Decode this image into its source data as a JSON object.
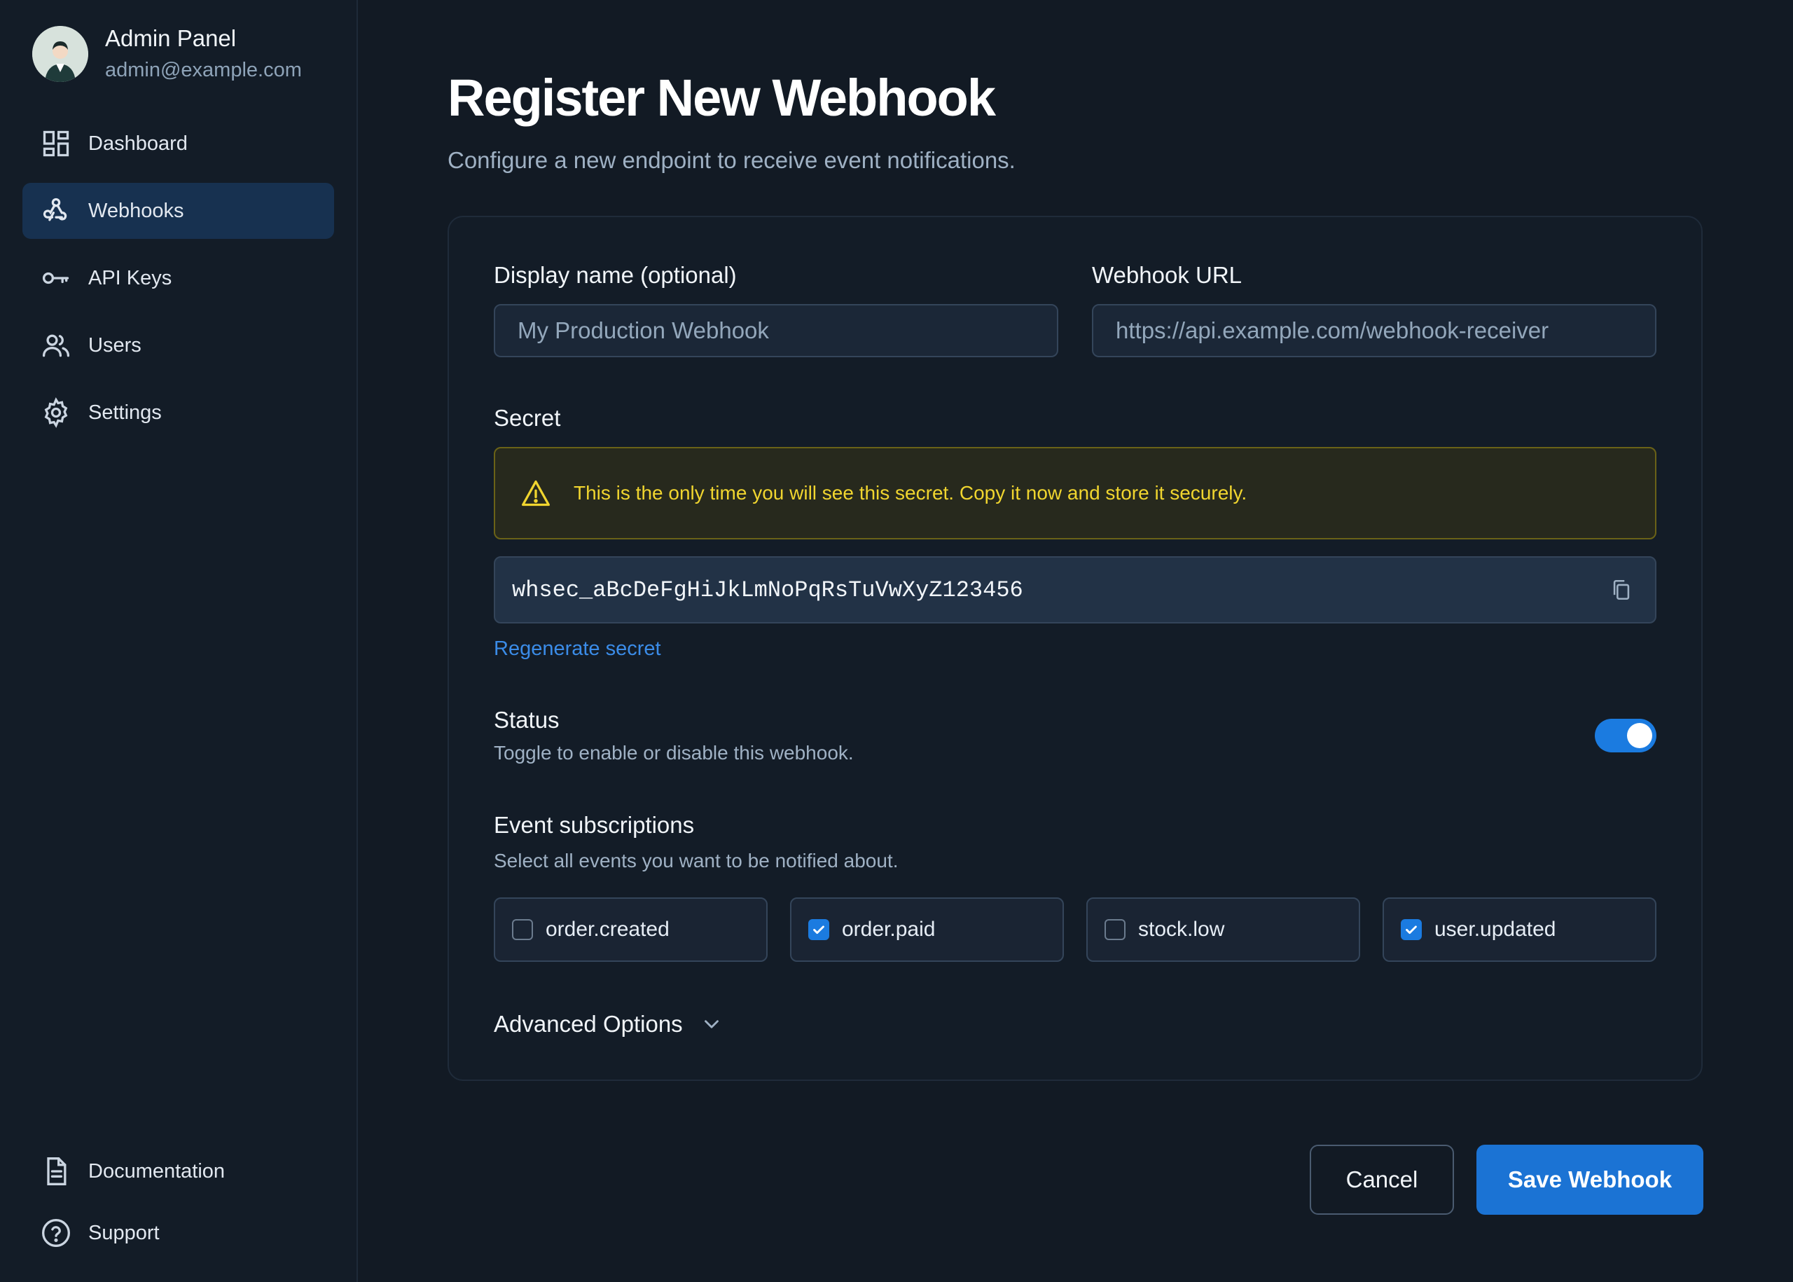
{
  "profile": {
    "name": "Admin Panel",
    "email": "admin@example.com"
  },
  "nav": {
    "items": [
      {
        "label": "Dashboard",
        "icon": "dashboard-icon"
      },
      {
        "label": "Webhooks",
        "icon": "webhooks-icon",
        "active": true
      },
      {
        "label": "API Keys",
        "icon": "key-icon"
      },
      {
        "label": "Users",
        "icon": "users-icon"
      },
      {
        "label": "Settings",
        "icon": "gear-icon"
      }
    ],
    "bottom": [
      {
        "label": "Documentation",
        "icon": "document-icon"
      },
      {
        "label": "Support",
        "icon": "help-circle-icon"
      }
    ]
  },
  "page": {
    "title": "Register New Webhook",
    "subtitle": "Configure a new endpoint to receive event notifications."
  },
  "form": {
    "display_name": {
      "label": "Display name (optional)",
      "placeholder": "My Production Webhook",
      "value": ""
    },
    "url": {
      "label": "Webhook URL",
      "placeholder": "https://api.example.com/webhook-receiver",
      "value": ""
    },
    "secret": {
      "label": "Secret",
      "warning": "This is the only time you will see this secret. Copy it now and store it securely.",
      "value": "whsec_aBcDeFgHiJkLmNoPqRsTuVwXyZ123456",
      "regenerate_label": "Regenerate secret"
    },
    "status": {
      "label": "Status",
      "help": "Toggle to enable or disable this webhook.",
      "enabled": true
    },
    "events": {
      "label": "Event subscriptions",
      "help": "Select all events you want to be notified about.",
      "items": [
        {
          "label": "order.created",
          "checked": false
        },
        {
          "label": "order.paid",
          "checked": true
        },
        {
          "label": "stock.low",
          "checked": false
        },
        {
          "label": "user.updated",
          "checked": true
        }
      ]
    },
    "advanced_label": "Advanced Options"
  },
  "actions": {
    "cancel_label": "Cancel",
    "save_label": "Save Webhook"
  },
  "colors": {
    "accent": "#1b73d4",
    "warning": "#f0d52f",
    "link": "#3b8ce8"
  }
}
